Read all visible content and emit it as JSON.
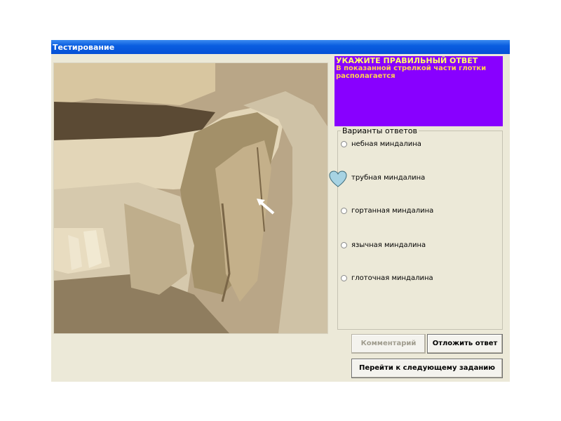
{
  "window": {
    "title": "Тестирование"
  },
  "question": {
    "header": "УКАЖИТЕ ПРАВИЛЬНЫЙ ОТВЕТ",
    "text": "В показанной стрелкой части глотки располагается"
  },
  "answers": {
    "legend": "Варианты ответов",
    "options": [
      {
        "label": "небная миндалина"
      },
      {
        "label": "трубная миндалина"
      },
      {
        "label": "гортанная миндалина"
      },
      {
        "label": "язычная миндалина"
      },
      {
        "label": "глоточная миндалина"
      }
    ]
  },
  "buttons": {
    "comment": "Комментарий",
    "postpone": "Отложить ответ",
    "next": "Перейти к следующему заданию"
  },
  "colors": {
    "title_bar": "#0a5ee0",
    "question_bg": "#8800ff",
    "question_header": "#ffff66",
    "question_text": "#ffd24d",
    "heart": "#a7d3e3"
  }
}
